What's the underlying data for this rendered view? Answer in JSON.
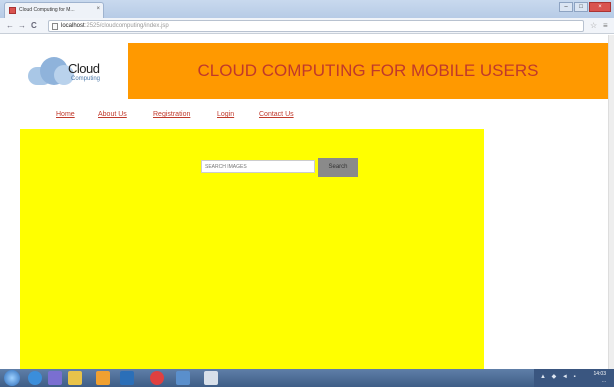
{
  "browser": {
    "tab_title": "Cloud Computing for M...",
    "tab_close": "×",
    "address_host": "localhost",
    "address_path": ":2525/cloudcomputing/index.jsp",
    "nav_back": "←",
    "nav_forward": "→",
    "nav_reload": "C",
    "star_icon": "star-icon",
    "window_buttons": [
      "–",
      "□",
      "×"
    ]
  },
  "logo": {
    "text": "Cloud",
    "subtext": "Computing"
  },
  "banner": {
    "title": "CLOUD COMPUTING FOR MOBILE USERS"
  },
  "nav": {
    "items": [
      {
        "label": "Home"
      },
      {
        "label": "About Us"
      },
      {
        "label": "Registration"
      },
      {
        "label": "Login"
      },
      {
        "label": "Contact Us"
      }
    ]
  },
  "search": {
    "placeholder": "SEARCH IMAGES",
    "button_label": "Search"
  },
  "taskbar": {
    "time": "14:03",
    "date": "..."
  },
  "colors": {
    "banner": "#ff9900",
    "banner_text": "#c0392b",
    "content_bg": "#ffff00",
    "nav_link": "#c0392b",
    "search_button": "#8a8a8a"
  }
}
